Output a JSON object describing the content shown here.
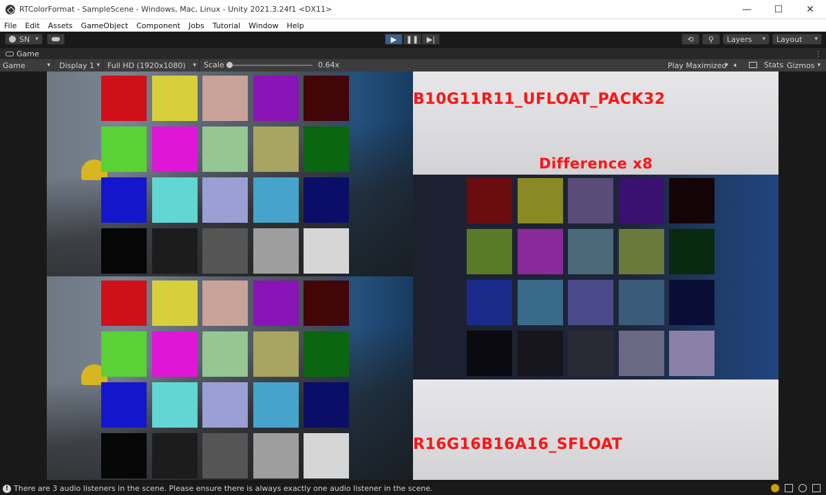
{
  "window": {
    "title": "RTColorFormat - SampleScene - Windows, Mac, Linux - Unity 2021.3.24f1 <DX11>",
    "minimize": "—",
    "maximize": "☐",
    "close": "✕"
  },
  "menu": [
    "File",
    "Edit",
    "Assets",
    "GameObject",
    "Component",
    "Jobs",
    "Tutorial",
    "Window",
    "Help"
  ],
  "toolbar": {
    "account": "SN",
    "layers": "Layers",
    "layout": "Layout"
  },
  "tab": {
    "label": "Game"
  },
  "game_toolbar": {
    "mode": "Game",
    "display": "Display 1",
    "resolution": "Full HD (1920x1080)",
    "scale_label": "Scale",
    "scale_value": "0.64x",
    "play_mode": "Play Maximized",
    "stats": "Stats",
    "gizmos": "Gizmos"
  },
  "viewport": {
    "top_format": "B10G11R11_UFLOAT_PACK32",
    "bottom_format": "R16G16B16A16_SFLOAT",
    "diff_label": "Difference x8",
    "palette": [
      [
        "#d01018",
        "#d8cf3c",
        "#c9a39a",
        "#8a14b6",
        "#420508"
      ],
      [
        "#5ad236",
        "#e016d6",
        "#96c692",
        "#a8a462",
        "#0a6610"
      ],
      [
        "#1416cc",
        "#62d6d2",
        "#9aa0d4",
        "#46a4cc",
        "#0a0e66"
      ],
      [
        "#060606",
        "#1c1c1c",
        "#555555",
        "#9e9e9e",
        "#d6d6d6"
      ]
    ],
    "diff_palette": [
      [
        "#6a0c10",
        "#8a8a24",
        "#5a4c78",
        "#3a1070",
        "#140408"
      ],
      [
        "#5a7a28",
        "#8a2a9a",
        "#4a6a7a",
        "#6a7a3a",
        "#0a2a10"
      ],
      [
        "#1a2a8a",
        "#3a6a8a",
        "#4a4a8a",
        "#3a5a7a",
        "#0a0e36"
      ],
      [
        "#0a0a10",
        "#16161c",
        "#2a2a34",
        "#6a6a84",
        "#8a80a8"
      ]
    ]
  },
  "status": {
    "message": "There are 3 audio listeners in the scene. Please ensure there is always exactly one audio listener in the scene."
  }
}
